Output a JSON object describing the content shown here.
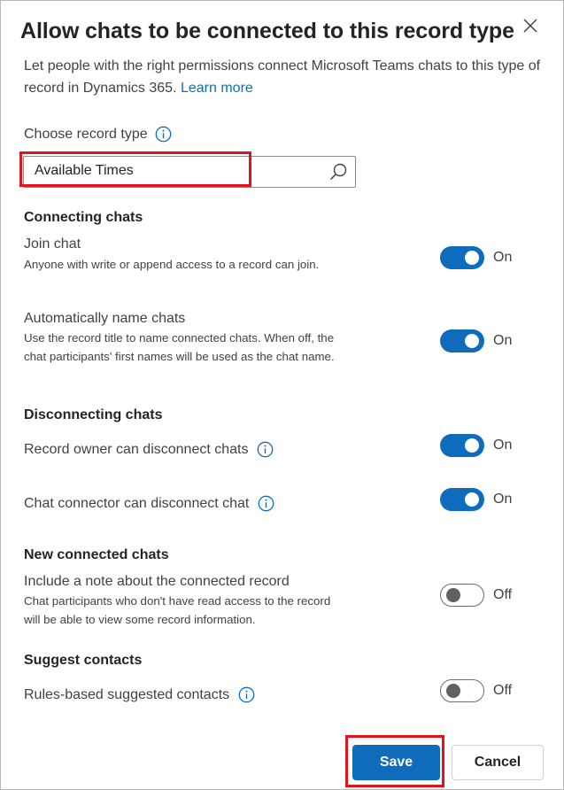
{
  "dialog": {
    "title": "Allow chats to be connected to this record type",
    "description": "Let people with the right permissions connect Microsoft Teams chats to this type of record in Dynamics 365.",
    "learn_more": "Learn more",
    "close_icon": "close-icon"
  },
  "record_type": {
    "label": "Choose record type",
    "value": "Available Times",
    "search_icon": "search-icon"
  },
  "sections": {
    "connecting": "Connecting chats",
    "disconnecting": "Disconnecting chats",
    "new_connected": "New connected chats",
    "suggest_contacts": "Suggest contacts"
  },
  "settings": {
    "join_chat": {
      "label": "Join chat",
      "description": "Anyone with write or append access to a record can join.",
      "state": "On"
    },
    "auto_name": {
      "label": "Automatically name chats",
      "description": "Use the record title to name connected chats. When off, the chat participants' first names will be used as the chat name.",
      "state": "On"
    },
    "owner_disconnect": {
      "label": "Record owner can disconnect chats",
      "state": "On"
    },
    "connector_disconnect": {
      "label": "Chat connector can disconnect chat",
      "state": "On"
    },
    "include_note": {
      "label": "Include a note about the connected record",
      "description": "Chat participants who don't have read access to the record will be able to view some record information.",
      "state": "Off"
    },
    "rules_contacts": {
      "label": "Rules-based suggested contacts",
      "state": "Off"
    }
  },
  "footer": {
    "save_label": "Save",
    "cancel_label": "Cancel"
  },
  "colors": {
    "accent": "#0f6cbd",
    "highlight": "#e0141e"
  }
}
